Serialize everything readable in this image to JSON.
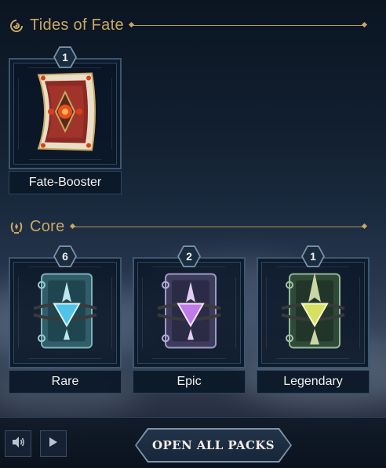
{
  "sections": {
    "tides": {
      "title": "Tides of Fate",
      "packs": [
        {
          "name": "Fate-Booster",
          "count": "1"
        }
      ]
    },
    "core": {
      "title": "Core",
      "packs": [
        {
          "name": "Rare",
          "count": "6",
          "gem_color": "#4fc3e8"
        },
        {
          "name": "Epic",
          "count": "2",
          "gem_color": "#c07be8"
        },
        {
          "name": "Legendary",
          "count": "1",
          "gem_color": "#d8e060"
        }
      ]
    }
  },
  "footer": {
    "sound_icon": "speaker-icon",
    "play_icon": "play-icon",
    "open_all_label": "OPEN ALL PACKS"
  },
  "colors": {
    "accent_gold": "#c9a862",
    "frame_blue": "#3d5570"
  }
}
